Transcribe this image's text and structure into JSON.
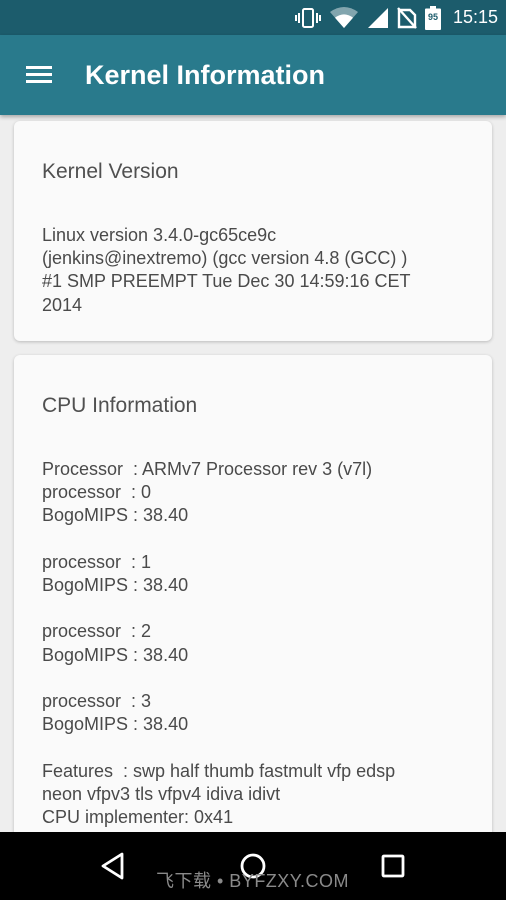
{
  "status_bar": {
    "time": "15:15",
    "battery_level": "95",
    "icons": [
      "vibrate-icon",
      "wifi-icon",
      "cellular-signal-icon",
      "no-sim-icon",
      "battery-icon"
    ]
  },
  "app_bar": {
    "menu_icon": "hamburger-menu-icon",
    "title": "Kernel Information",
    "background": "#297a8c"
  },
  "kernel_card": {
    "title": "Kernel Version",
    "body": "Linux version 3.4.0-gc65ce9c\n(jenkins@inextremo) (gcc version 4.8 (GCC) )\n#1 SMP PREEMPT Tue Dec 30 14:59:16 CET\n2014"
  },
  "cpu_card": {
    "title": "CPU Information",
    "body": "Processor  : ARMv7 Processor rev 3 (v7l)\nprocessor  : 0\nBogoMIPS : 38.40\n\nprocessor  : 1\nBogoMIPS : 38.40\n\nprocessor  : 2\nBogoMIPS : 38.40\n\nprocessor  : 3\nBogoMIPS : 38.40\n\nFeatures  : swp half thumb fastmult vfp edsp\nneon vfpv3 tls vfpv4 idiva idivt\nCPU implementer: 0x41"
  },
  "nav_bar": {
    "buttons": [
      "back-icon",
      "home-icon",
      "recents-icon"
    ],
    "watermark": "飞下载 • BYFZXY.COM"
  }
}
